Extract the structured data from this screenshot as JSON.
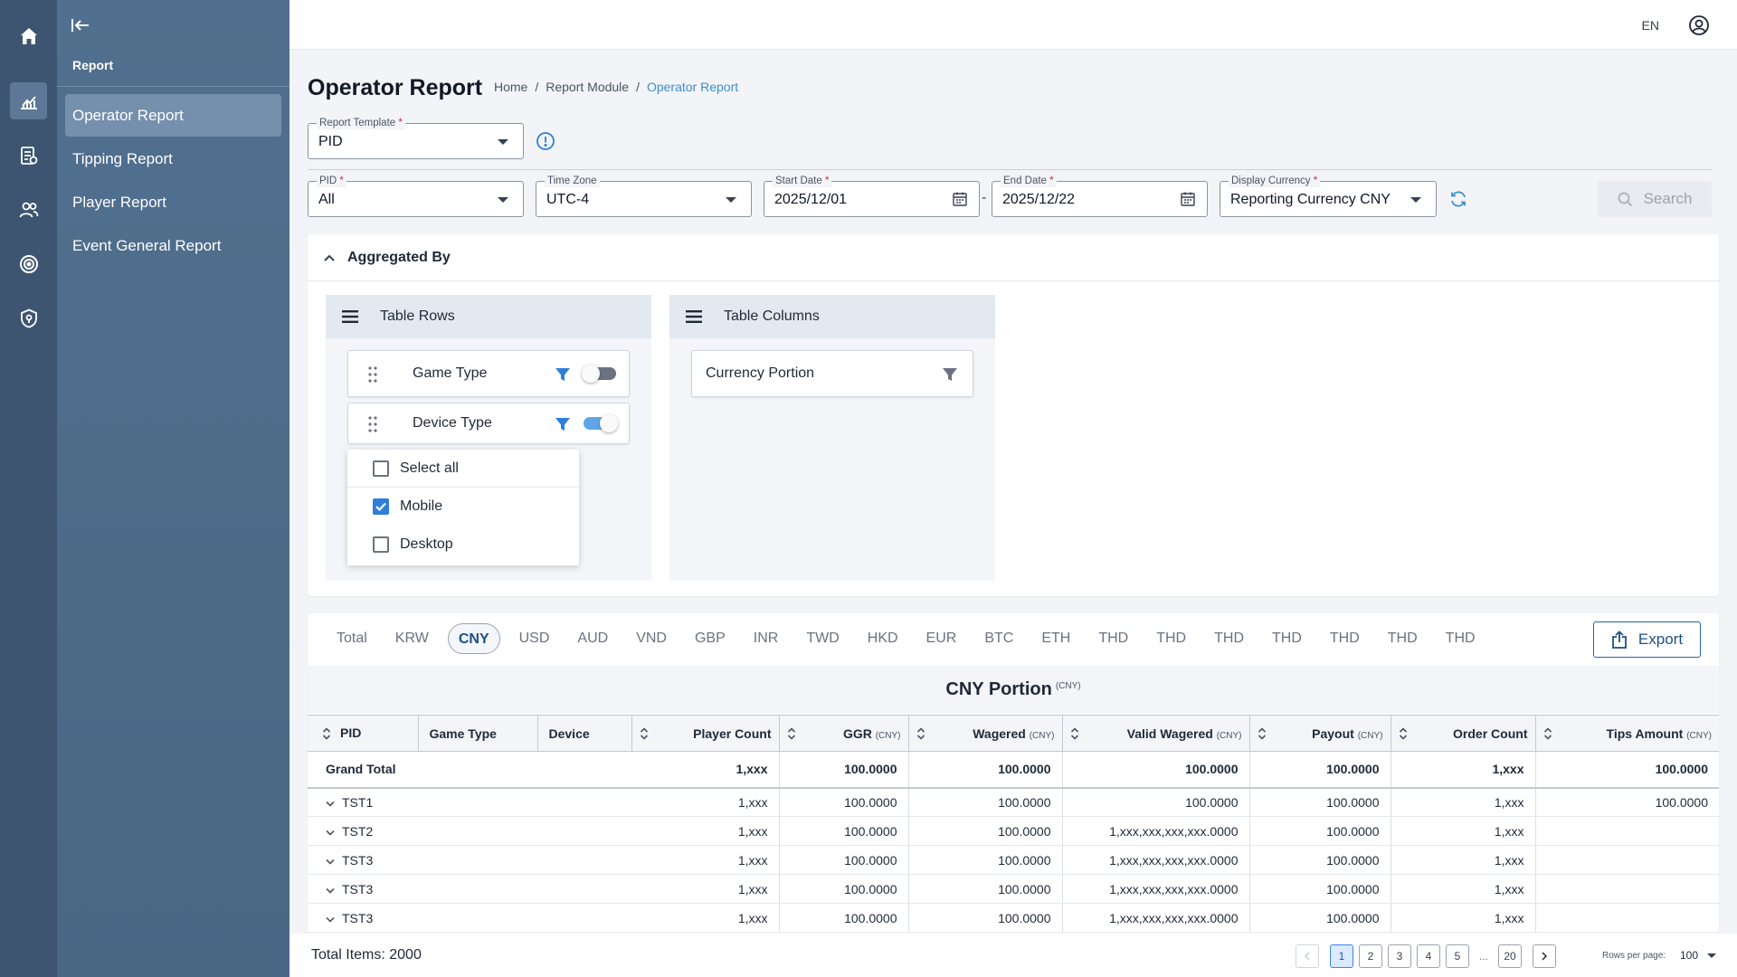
{
  "rail": {
    "icons": [
      "home-icon",
      "chart-icon",
      "report-doc-icon",
      "users-icon",
      "target-icon",
      "shield-icon"
    ]
  },
  "sidebar": {
    "title": "Report",
    "items": [
      {
        "label": "Operator Report",
        "active": true
      },
      {
        "label": "Tipping Report"
      },
      {
        "label": "Player Report"
      },
      {
        "label": "Event General Report"
      }
    ]
  },
  "topbar": {
    "language": "EN"
  },
  "page": {
    "title": "Operator Report",
    "breadcrumb": [
      "Home",
      "Report Module",
      "Operator Report"
    ]
  },
  "filters": {
    "report_template": {
      "label": "Report Template",
      "value": "PID"
    },
    "pid": {
      "label": "PID",
      "value": "All"
    },
    "time_zone": {
      "label": "Time Zone",
      "value": "UTC-4"
    },
    "start_date": {
      "label": "Start Date",
      "value": "2025/12/01"
    },
    "end_date": {
      "label": "End Date",
      "value": "2025/12/22"
    },
    "date_separator": "-",
    "display_currency": {
      "label": "Display Currency",
      "value": "Reporting Currency CNY"
    },
    "search_label": "Search",
    "required_mark": "*"
  },
  "aggregated": {
    "title": "Aggregated By",
    "rows_panel": {
      "title": "Table Rows",
      "items": [
        {
          "label": "Game Type",
          "toggle_on": false
        },
        {
          "label": "Device Type",
          "toggle_on": true
        }
      ]
    },
    "columns_panel": {
      "title": "Table Columns",
      "items": [
        {
          "label": "Currency Portion"
        }
      ]
    },
    "dropdown": {
      "options": [
        {
          "label": "Select all",
          "checked": false
        },
        {
          "label": "Mobile",
          "checked": true
        },
        {
          "label": "Desktop",
          "checked": false
        }
      ]
    }
  },
  "results": {
    "tabs": [
      "Total",
      "KRW",
      "CNY",
      "USD",
      "AUD",
      "VND",
      "GBP",
      "INR",
      "TWD",
      "HKD",
      "EUR",
      "BTC",
      "ETH",
      "THD",
      "THD",
      "THD",
      "THD",
      "THD",
      "THD",
      "THD"
    ],
    "active_tab": "CNY",
    "export_label": "Export",
    "portion_title": "CNY Portion",
    "portion_unit": "(CNY)",
    "columns": [
      {
        "label": "PID",
        "unit": ""
      },
      {
        "label": "Game Type",
        "unit": ""
      },
      {
        "label": "Device",
        "unit": ""
      },
      {
        "label": "Player Count",
        "unit": ""
      },
      {
        "label": "GGR",
        "unit": "(CNY)"
      },
      {
        "label": "Wagered",
        "unit": "(CNY)"
      },
      {
        "label": "Valid Wagered",
        "unit": "(CNY)"
      },
      {
        "label": "Payout",
        "unit": "(CNY)"
      },
      {
        "label": "Order Count",
        "unit": ""
      },
      {
        "label": "Tips Amount",
        "unit": "(CNY)"
      }
    ],
    "grand_total": {
      "label": "Grand Total",
      "values": [
        "1,xxx",
        "100.0000",
        "100.0000",
        "100.0000",
        "100.0000",
        "1,xxx",
        "100.0000"
      ]
    },
    "rows": [
      {
        "pid": "TST1",
        "values": [
          "1,xxx",
          "100.0000",
          "100.0000",
          "100.0000",
          "100.0000",
          "1,xxx",
          "100.0000"
        ]
      },
      {
        "pid": "TST2",
        "values": [
          "1,xxx",
          "100.0000",
          "100.0000",
          "1,xxx,xxx,xxx,xxx.0000",
          "100.0000",
          "1,xxx",
          ""
        ]
      },
      {
        "pid": "TST3",
        "values": [
          "1,xxx",
          "100.0000",
          "100.0000",
          "1,xxx,xxx,xxx,xxx.0000",
          "100.0000",
          "1,xxx",
          ""
        ]
      },
      {
        "pid": "TST3",
        "values": [
          "1,xxx",
          "100.0000",
          "100.0000",
          "1,xxx,xxx,xxx,xxx.0000",
          "100.0000",
          "1,xxx",
          ""
        ]
      },
      {
        "pid": "TST3",
        "values": [
          "1,xxx",
          "100.0000",
          "100.0000",
          "1,xxx,xxx,xxx,xxx.0000",
          "100.0000",
          "1,xxx",
          ""
        ]
      }
    ]
  },
  "footer": {
    "total_items": "Total Items: 2000",
    "pages": [
      "1",
      "2",
      "3",
      "4",
      "5"
    ],
    "ellipsis": "...",
    "last_page": "20",
    "current_page": "1",
    "rows_per_page_label": "Rows per page:",
    "rows_per_page_value": "100"
  },
  "colors": {
    "rail": "#3d5570",
    "sidebar": "#4f6d8c",
    "accent": "#2f7ed8",
    "breadcrumb_current": "#3b8fd1"
  }
}
